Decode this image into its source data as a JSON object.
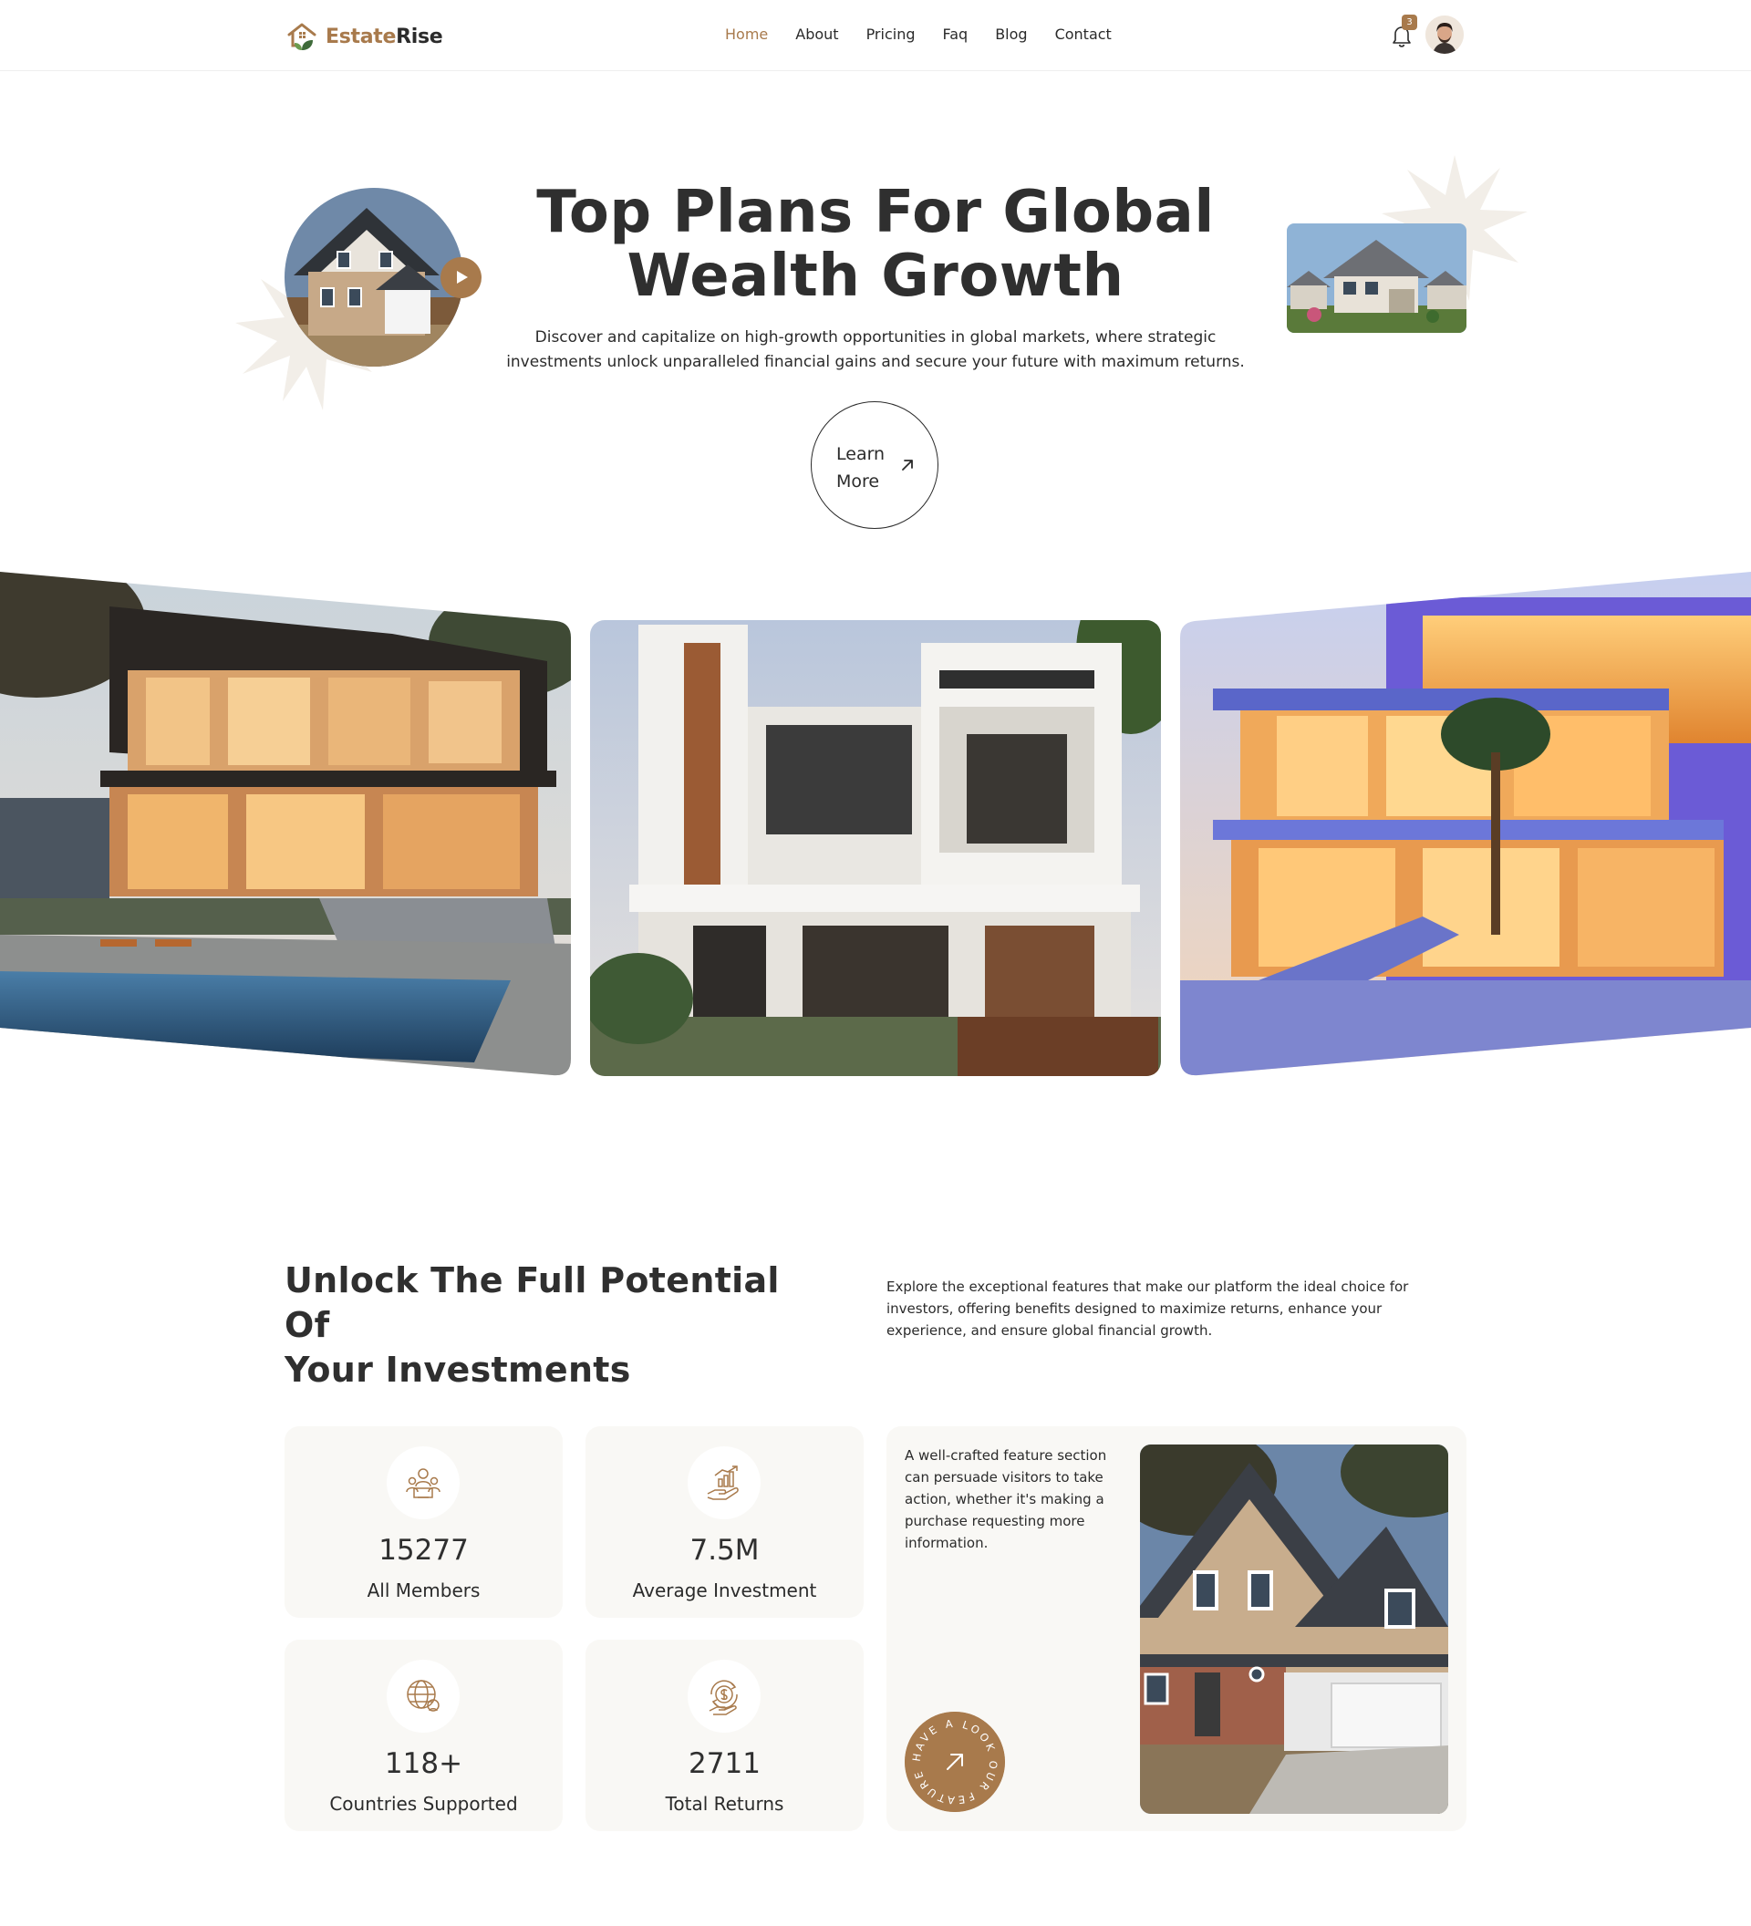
{
  "brand": {
    "name_part1": "Estate",
    "name_part2": "Rise",
    "accent": "#a87a4c",
    "text": "#2b2b2b"
  },
  "nav": {
    "items": [
      {
        "label": "Home",
        "active": true
      },
      {
        "label": "About"
      },
      {
        "label": "Pricing"
      },
      {
        "label": "Faq"
      },
      {
        "label": "Blog"
      },
      {
        "label": "Contact"
      }
    ],
    "notification_count": "3",
    "icons": [
      "bell-icon",
      "user-avatar"
    ]
  },
  "hero": {
    "title_line1": "Top Plans For Global",
    "title_line2": "Wealth Growth",
    "description": "Discover and capitalize on high-growth opportunities in global markets, where strategic investments unlock unparalleled financial gains and secure your future with maximum returns.",
    "cta_line1": "Learn",
    "cta_line2": "More"
  },
  "features": {
    "title_line1": "Unlock The Full Potential Of",
    "title_line2": "Your Investments",
    "description": "Explore the exceptional features that make our platform the ideal choice for investors, offering benefits designed to maximize returns, enhance your experience, and ensure global financial growth.",
    "stats": [
      {
        "value": "15277",
        "label": "All Members",
        "icon": "members-icon"
      },
      {
        "value": "7.5M",
        "label": "Average Investment",
        "icon": "investment-icon"
      },
      {
        "value": "118+",
        "label": "Countries Supported",
        "icon": "globe-icon"
      },
      {
        "value": "2711",
        "label": "Total Returns",
        "icon": "returns-icon"
      }
    ],
    "promo_text": "A well-crafted feature section can persuade visitors to take action, whether it's making a purchase requesting more information.",
    "badge_text": "HAVE A LOOK OUR FEATURE"
  }
}
